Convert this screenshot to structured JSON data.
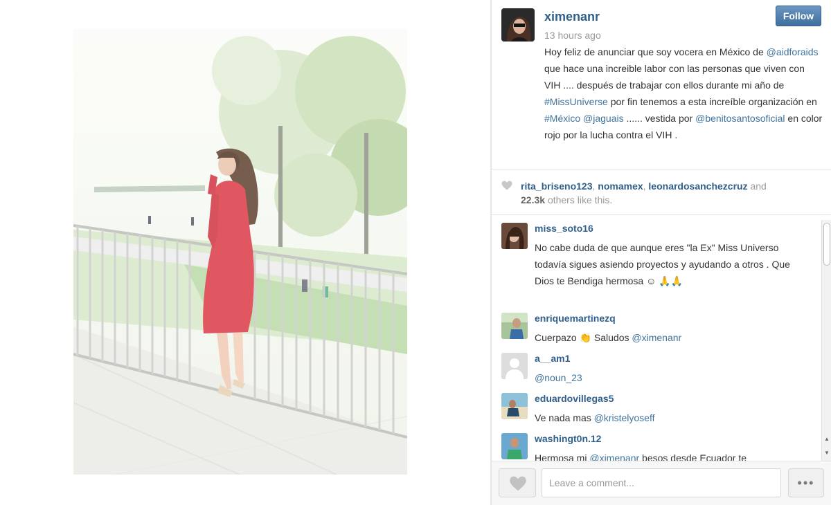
{
  "post": {
    "owner": "ximenanr",
    "timestamp": "13 hours ago",
    "follow_label": "Follow",
    "caption": [
      {
        "t": "Hoy feliz de anunciar que soy vocera en México de ",
        "tag": false
      },
      {
        "t": "@aidforaids",
        "tag": true
      },
      {
        "t": " que hace una increible labor con las personas que viven con VIH .... después de trabajar con ellos durante mi año de ",
        "tag": false
      },
      {
        "t": "#MissUniverse",
        "tag": true
      },
      {
        "t": " por fin tenemos a esta increíble organización en ",
        "tag": false
      },
      {
        "t": "#México",
        "tag": true
      },
      {
        "t": " ",
        "tag": false
      },
      {
        "t": "@jaguais",
        "tag": true
      },
      {
        "t": " ...... vestida por ",
        "tag": false
      },
      {
        "t": "@benitosantosoficial",
        "tag": true
      },
      {
        "t": " en color rojo por la lucha contra el VIH .",
        "tag": false
      }
    ]
  },
  "likes": {
    "users": [
      "rita_briseno123",
      "nomamex",
      "leonardosanchezcruz"
    ],
    "and_word": "and",
    "count": "22.3k",
    "suffix": "others like this."
  },
  "comments": [
    {
      "user": "miss_soto16",
      "text": [
        {
          "t": "No cabe duda de que aunque eres \"la Ex\" Miss Universo todavía sigues asiendo proyectos y ayudando a otros . Que Dios te Bendiga hermosa ☺ 🙏🙏",
          "tag": false
        }
      ],
      "avatar": "avatar-woman"
    },
    {
      "user": "enriquemartinezq",
      "text": [
        {
          "t": "Cuerpazo 👏 Saludos ",
          "tag": false
        },
        {
          "t": "@ximenanr",
          "tag": true
        }
      ],
      "avatar": "avatar-man-outdoor"
    },
    {
      "user": "a__am1",
      "text": [
        {
          "t": "@noun_23",
          "tag": true
        }
      ],
      "avatar": "avatar-default"
    },
    {
      "user": "eduardovillegas5",
      "text": [
        {
          "t": "Ve nada mas ",
          "tag": false
        },
        {
          "t": "@kristelyoseff",
          "tag": true
        }
      ],
      "avatar": "avatar-beach"
    },
    {
      "user": "washingt0n.12",
      "text": [
        {
          "t": "Hermosa mi ",
          "tag": false
        },
        {
          "t": "@ximenanr",
          "tag": true
        },
        {
          "t": " besos desde Ecuador te",
          "tag": false
        }
      ],
      "avatar": "avatar-green"
    }
  ],
  "footer": {
    "comment_placeholder": "Leave a comment...",
    "more_label": "•••"
  },
  "colors": {
    "link": "#2f5f8a",
    "tag": "#3f729b",
    "follow_button": "#4a7aab",
    "dress": "#d9323f"
  }
}
